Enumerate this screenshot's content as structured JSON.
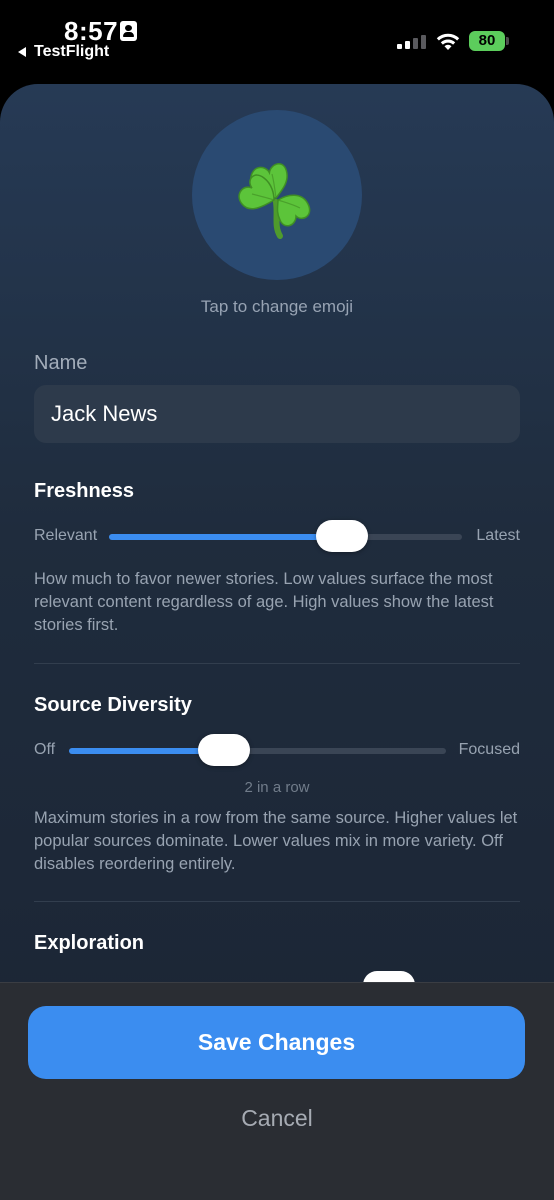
{
  "status_bar": {
    "time": "8:57",
    "back_app": "TestFlight",
    "battery": "80",
    "battery_color": "#5ccd5c"
  },
  "emoji": {
    "symbol": "☘️",
    "hint": "Tap to change emoji"
  },
  "name": {
    "label": "Name",
    "value": "Jack News"
  },
  "freshness": {
    "title": "Freshness",
    "min_label": "Relevant",
    "max_label": "Latest",
    "value": 0.66,
    "description": "How much to favor newer stories. Low values surface the most relevant content regardless of age. High values show the latest stories first."
  },
  "source_diversity": {
    "title": "Source Diversity",
    "min_label": "Off",
    "max_label": "Focused",
    "value": 0.41,
    "value_note": "2 in a row",
    "description": "Maximum stories in a row from the same source. Higher values let popular sources dominate. Lower values mix in more variety. Off disables reordering entirely."
  },
  "exploration": {
    "title": "Exploration"
  },
  "actions": {
    "save_label": "Save Changes",
    "cancel_label": "Cancel"
  },
  "colors": {
    "accent": "#3b8df0",
    "sheet_top": "#263a55",
    "sheet_bottom": "#1b2433"
  }
}
